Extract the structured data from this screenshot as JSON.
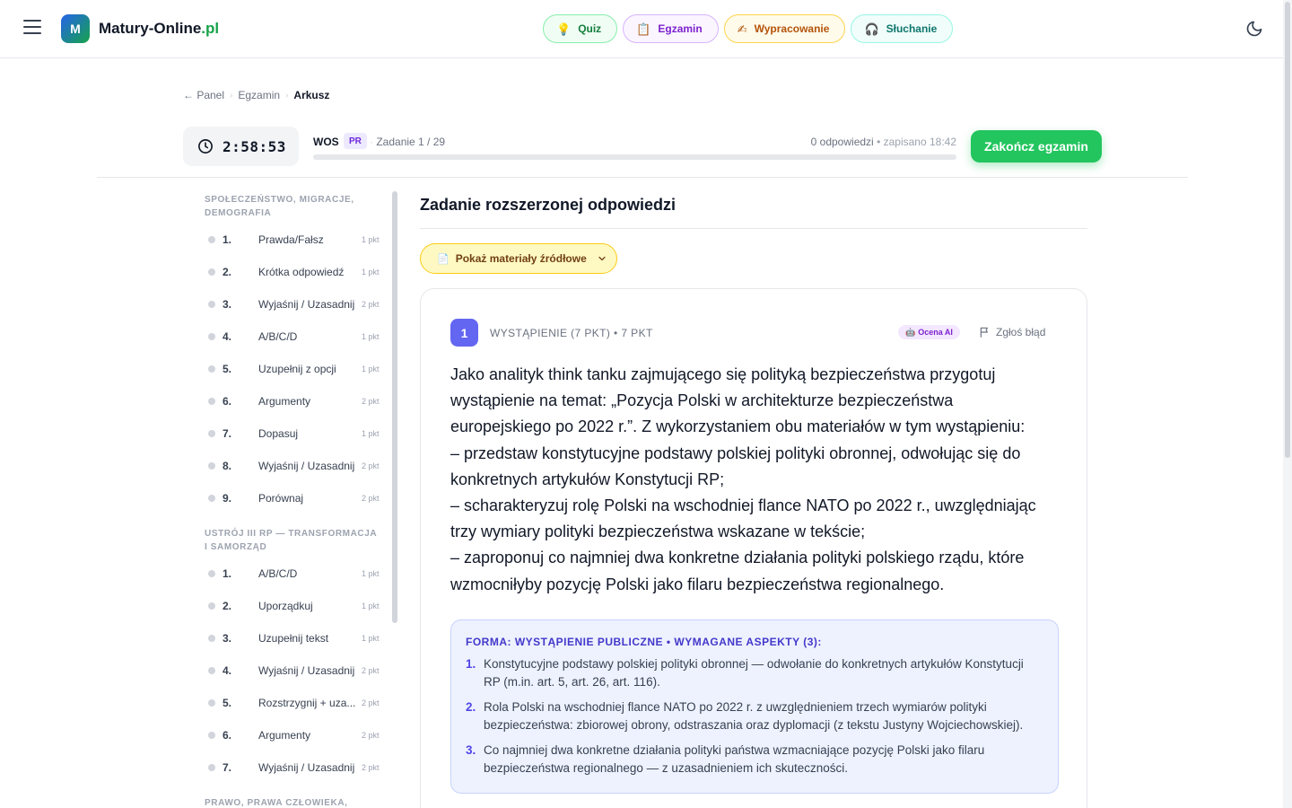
{
  "brand": {
    "badge": "M",
    "name": "Matury-Online",
    "tld": ".pl"
  },
  "nav": [
    {
      "label": "Quiz",
      "icon": "lightbulb-icon",
      "glyph": "💡"
    },
    {
      "label": "Egzamin",
      "icon": "clipboard-icon",
      "glyph": "📋"
    },
    {
      "label": "Wypracowanie",
      "icon": "writing-hand-icon",
      "glyph": "✍"
    },
    {
      "label": "Słuchanie",
      "icon": "headphones-icon",
      "glyph": "🎧"
    }
  ],
  "breadcrumb": {
    "back": "← Panel",
    "middle": "Egzamin",
    "current": "Arkusz"
  },
  "exam": {
    "timer": "2:58:53",
    "subject": "WOS",
    "level": "PR",
    "task_counter": "Zadanie 1 / 29",
    "answers": "0 odpowiedzi",
    "saved": "• zapisano 18:42",
    "progress": 0,
    "finish_label": "Zakończ egzamin"
  },
  "sidebar": {
    "sections": [
      {
        "title": "SPOŁECZEŃSTWO, MIGRACJE, DEMOGRAFIA",
        "tasks": [
          {
            "num": "1.",
            "label": "Prawda/Fałsz",
            "pts": "1 pkt"
          },
          {
            "num": "2.",
            "label": "Krótka odpowiedź",
            "pts": "1 pkt"
          },
          {
            "num": "3.",
            "label": "Wyjaśnij / Uzasadnij",
            "pts": "2 pkt"
          },
          {
            "num": "4.",
            "label": "A/B/C/D",
            "pts": "1 pkt"
          },
          {
            "num": "5.",
            "label": "Uzupełnij z opcji",
            "pts": "1 pkt"
          },
          {
            "num": "6.",
            "label": "Argumenty",
            "pts": "2 pkt"
          },
          {
            "num": "7.",
            "label": "Dopasuj",
            "pts": "1 pkt"
          },
          {
            "num": "8.",
            "label": "Wyjaśnij / Uzasadnij",
            "pts": "2 pkt"
          },
          {
            "num": "9.",
            "label": "Porównaj",
            "pts": "2 pkt"
          }
        ]
      },
      {
        "title": "USTRÓJ III RP — TRANSFORMACJA I SAMORZĄD",
        "tasks": [
          {
            "num": "1.",
            "label": "A/B/C/D",
            "pts": "1 pkt"
          },
          {
            "num": "2.",
            "label": "Uporządkuj",
            "pts": "1 pkt"
          },
          {
            "num": "3.",
            "label": "Uzupełnij tekst",
            "pts": "1 pkt"
          },
          {
            "num": "4.",
            "label": "Wyjaśnij / Uzasadnij",
            "pts": "2 pkt"
          },
          {
            "num": "5.",
            "label": "Rozstrzygnij + uza...",
            "pts": "2 pkt"
          },
          {
            "num": "6.",
            "label": "Argumenty",
            "pts": "2 pkt"
          },
          {
            "num": "7.",
            "label": "Wyjaśnij / Uzasadnij",
            "pts": "2 pkt"
          }
        ]
      },
      {
        "title": "PRAWO, PRAWA CZŁOWIEKA,",
        "tasks": []
      }
    ]
  },
  "main": {
    "title": "Zadanie rozszerzonej odpowiedzi",
    "sources_button": "Pokaż materiały źródłowe",
    "question": {
      "number": "1",
      "meta": "WYSTĄPIENIE (7 PKT) • 7 PKT",
      "ai_badge": "Ocena AI",
      "report": "Zgłoś błąd",
      "text": [
        "Jako analityk think tanku zajmującego się polityką bezpieczeństwa przygotuj wystąpienie na temat: „Pozycja Polski w architekturze bezpieczeństwa europejskiego po 2022 r.”. Z wykorzystaniem obu materiałów w tym wystąpieniu:",
        "– przedstaw konstytucyjne podstawy polskiej polityki obronnej, odwołując się do konkretnych artykułów Konstytucji RP;",
        "– scharakteryzuj rolę Polski na wschodniej flance NATO po 2022 r., uwzględniając trzy wymiary polityki bezpieczeństwa wskazane w tekście;",
        "– zaproponuj co najmniej dwa konkretne działania polityki polskiego rządu, które wzmocniłyby pozycję Polski jako filaru bezpieczeństwa regionalnego."
      ],
      "aspects_head": "FORMA: WYSTĄPIENIE PUBLICZNE • WYMAGANE ASPEKTY (3):",
      "aspects": [
        {
          "n": "1.",
          "text": "Konstytucyjne podstawy polskiej polityki obronnej — odwołanie do konkretnych artykułów Konstytucji RP (m.in. art. 5, art. 26, art. 116)."
        },
        {
          "n": "2.",
          "text": "Rola Polski na wschodniej flance NATO po 2022 r. z uwzględnieniem trzech wymiarów polityki bezpieczeństwa: zbiorowej obrony, odstraszania oraz dyplomacji (z tekstu Justyny Wojciechowskiej)."
        },
        {
          "n": "3.",
          "text": "Co najmniej dwa konkretne działania polityki państwa wzmacniające pozycję Polski jako filaru bezpieczeństwa regionalnego — z uzasadnieniem ich skuteczności."
        }
      ]
    }
  }
}
